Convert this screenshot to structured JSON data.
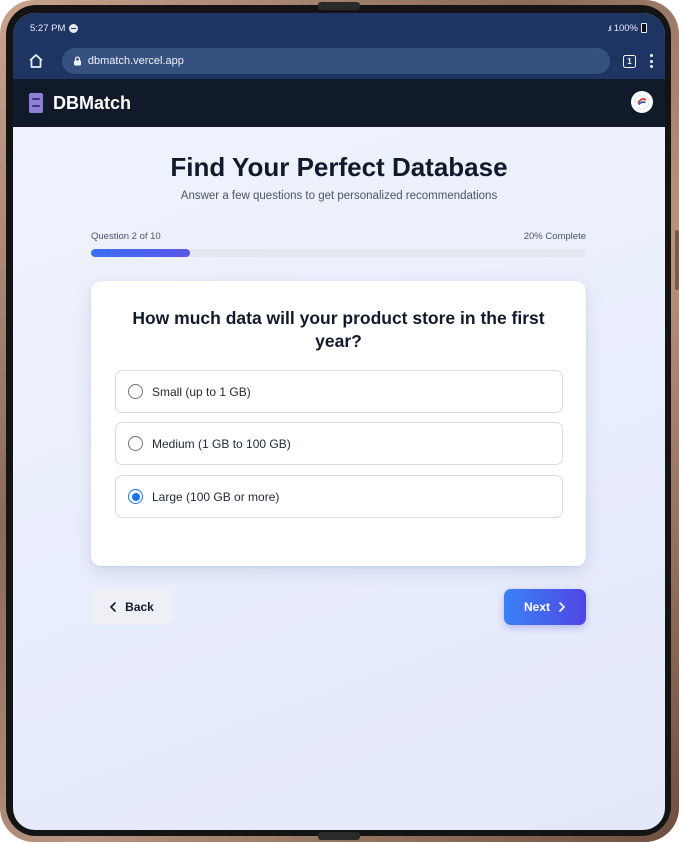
{
  "status": {
    "time": "5:27 PM",
    "battery": "100%"
  },
  "browser": {
    "url": "dbmatch.vercel.app",
    "tab_count": "1"
  },
  "app": {
    "title": "DBMatch"
  },
  "quiz": {
    "title": "Find Your Perfect Database",
    "subtitle": "Answer a few questions to get personalized recommendations",
    "progress_label": "Question 2 of 10",
    "progress_percent_label": "20% Complete",
    "progress": 0.2,
    "question": "How much data will your product store in the first year?",
    "options": [
      {
        "label": "Small (up to 1 GB)",
        "selected": false
      },
      {
        "label": "Medium (1 GB to 100 GB)",
        "selected": false
      },
      {
        "label": "Large (100 GB or more)",
        "selected": true
      }
    ],
    "back_label": "Back",
    "next_label": "Next"
  },
  "colors": {
    "accent": "#1a73e8",
    "header_bg": "#111a2b",
    "browser_bg": "#1e3563"
  }
}
